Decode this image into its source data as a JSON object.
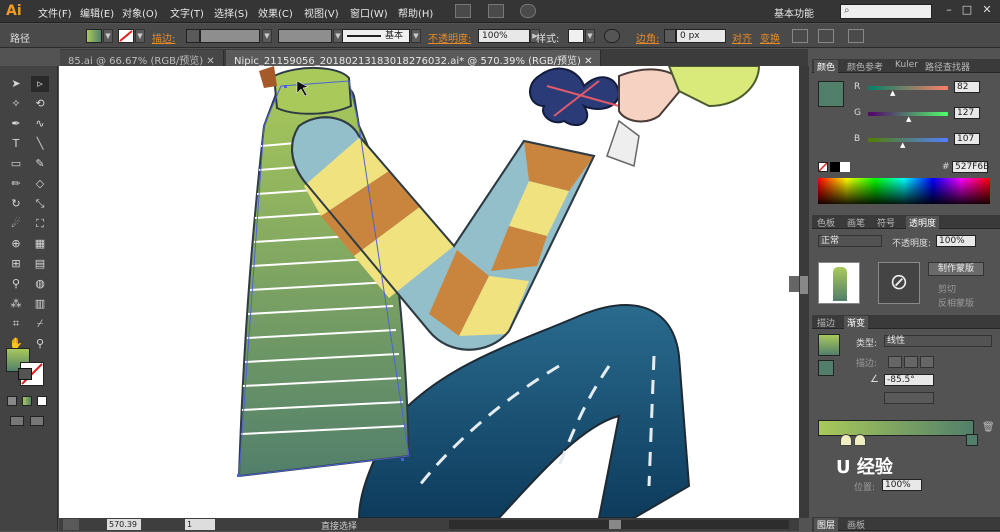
{
  "app": {
    "logo": "Ai",
    "workspace": "基本功能"
  },
  "menu": [
    "文件(F)",
    "编辑(E)",
    "对象(O)",
    "文字(T)",
    "选择(S)",
    "效果(C)",
    "视图(V)",
    "窗口(W)",
    "帮助(H)"
  ],
  "control": {
    "selection_type": "路径",
    "stroke_label": "描边:",
    "brush_label": "基本",
    "opacity_label": "不透明度:",
    "opacity_value": "100%",
    "style_label": "样式:",
    "corner_label": "边角:",
    "corner_value": "0 px",
    "align_label": "对齐",
    "transform_label": "变换"
  },
  "tabs": [
    {
      "label": "85.ai @ 66.67% (RGB/预览)",
      "active": false
    },
    {
      "label": "Nipic_21159056_20180213183018276032.ai* @ 570.39% (RGB/预览)",
      "active": true
    }
  ],
  "status": {
    "zoom": "570.39",
    "page": "1",
    "tool_name": "直接选择"
  },
  "color_panel": {
    "tabs": [
      "颜色",
      "颜色参考",
      "Kuler",
      "路径查找器"
    ],
    "r_label": "R",
    "r_value": "82",
    "g_label": "G",
    "g_value": "127",
    "b_label": "B",
    "b_value": "107",
    "hex_label": "#",
    "hex_value": "527F6B",
    "swatch": "#527f6b"
  },
  "transparency_panel": {
    "tabs": [
      "色板",
      "画笔",
      "符号",
      "透明度"
    ],
    "blend_mode": "正常",
    "opacity_label": "不透明度:",
    "opacity_value": "100%",
    "make_mask": "制作蒙版",
    "clip": "剪切",
    "invert": "反相蒙版"
  },
  "gradient_panel": {
    "tabs": [
      "描边",
      "渐变"
    ],
    "type_label": "类型:",
    "type_value": "线性",
    "stroke_label": "描边:",
    "angle_value": "-85.5°",
    "position_label": "位置:",
    "position_value": "100%",
    "start_color": "#a9c95a",
    "end_color": "#527f6b"
  },
  "bottom_panel_tabs": [
    "图层",
    "画板"
  ],
  "watermark": "U 经验"
}
